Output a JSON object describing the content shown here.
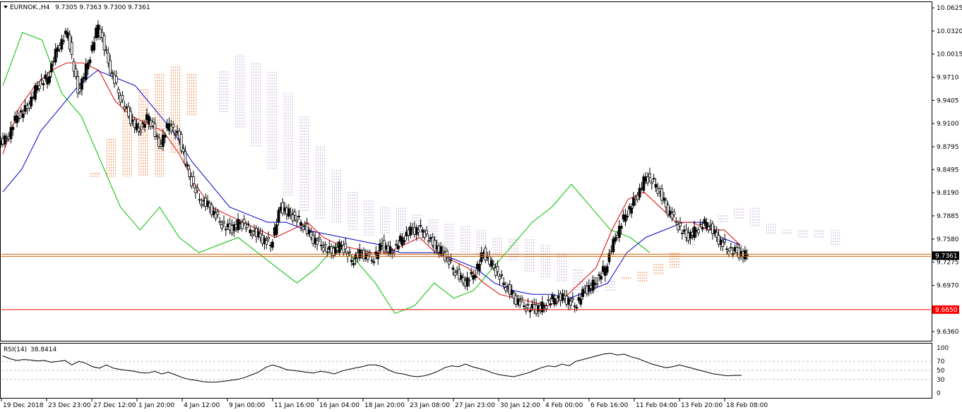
{
  "header": {
    "symbol_label": "EURNOK.,H4",
    "ohlc_label": "9.7305 9.7363 9.7300 9.7361",
    "menu_icon": "triangle-down-icon"
  },
  "colors": {
    "bull_body": "#000000",
    "bear_body": "#ffffff",
    "tenkan": "#dd0000",
    "kijun": "#0000cc",
    "chikou": "#00c000",
    "senkou_a": "#f08040",
    "senkou_b": "#c8b0d8",
    "price_line": "#d06000",
    "support_line": "#ff0000",
    "rsi_line": "#000000",
    "level_line": "#c0c0c0"
  },
  "chart_data": [
    {
      "type": "candlestick",
      "name": "EURNOK.,H4",
      "title": "EURNOK.,H4",
      "ohlc": {
        "open": 9.7305,
        "high": 9.7363,
        "low": 9.73,
        "close": 9.7361
      },
      "y_ticks": [
        "10.0625",
        "10.0320",
        "10.0015",
        "9.9710",
        "9.9405",
        "9.9100",
        "9.8795",
        "9.8495",
        "9.8190",
        "9.7885",
        "9.7580",
        "9.7275",
        "9.6970",
        "9.6360"
      ],
      "ylim": [
        9.624,
        10.07
      ],
      "x_ticks": [
        "19 Dec 2018",
        "23 Dec 23:00",
        "27 Dec 12:00",
        "1 Jan 20:00",
        "4 Jan 12:00",
        "9 Jan 00:00",
        "11 Jan 16:00",
        "16 Jan 04:00",
        "18 Jan 20:00",
        "23 Jan 08:00",
        "27 Jan 23:00",
        "30 Jan 12:00",
        "4 Feb 00:00",
        "6 Feb 16:00",
        "11 Feb 04:00",
        "13 Feb 20:00",
        "18 Feb 08:00"
      ],
      "current_price": {
        "value": 9.7361,
        "label": "9.7361"
      },
      "horizontal_line": {
        "value": 9.665,
        "label": "9.6650"
      },
      "close_path": [
        9.89,
        9.92,
        9.93,
        9.96,
        9.97,
        10.01,
        10.03,
        9.95,
        9.99,
        10.04,
        9.99,
        9.95,
        9.92,
        9.9,
        9.92,
        9.88,
        9.91,
        9.89,
        9.84,
        9.81,
        9.8,
        9.78,
        9.77,
        9.78,
        9.77,
        9.76,
        9.75,
        9.8,
        9.79,
        9.78,
        9.76,
        9.75,
        9.74,
        9.75,
        9.73,
        9.74,
        9.73,
        9.75,
        9.74,
        9.76,
        9.77,
        9.77,
        9.75,
        9.74,
        9.72,
        9.7,
        9.71,
        9.74,
        9.72,
        9.7,
        9.68,
        9.67,
        9.665,
        9.67,
        9.68,
        9.68,
        9.67,
        9.69,
        9.7,
        9.72,
        9.76,
        9.79,
        9.81,
        9.84,
        9.83,
        9.8,
        9.78,
        9.76,
        9.77,
        9.78,
        9.76,
        9.745,
        9.74,
        9.736
      ],
      "ichimoku": {
        "tenkan": [
          9.87,
          9.93,
          9.96,
          9.98,
          9.99,
          9.99,
          9.98,
          9.94,
          9.92,
          9.91,
          9.9,
          9.87,
          9.83,
          9.8,
          9.79,
          9.78,
          9.77,
          9.76,
          9.77,
          9.78,
          9.76,
          9.75,
          9.745,
          9.74,
          9.74,
          9.75,
          9.76,
          9.74,
          9.73,
          9.72,
          9.7,
          9.685,
          9.68,
          9.675,
          9.67,
          9.68,
          9.7,
          9.72,
          9.77,
          9.81,
          9.82,
          9.8,
          9.78,
          9.78,
          9.77,
          9.77,
          9.75
        ],
        "kijun": [
          9.82,
          9.85,
          9.9,
          9.93,
          9.96,
          9.98,
          9.97,
          9.96,
          9.93,
          9.9,
          9.86,
          9.83,
          9.8,
          9.79,
          9.78,
          9.78,
          9.77,
          9.765,
          9.76,
          9.755,
          9.75,
          9.74,
          9.74,
          9.74,
          9.73,
          9.72,
          9.7,
          9.69,
          9.685,
          9.685,
          9.68,
          9.69,
          9.7,
          9.74,
          9.76,
          9.77,
          9.78,
          9.78,
          9.76,
          9.75
        ],
        "chikou": [
          9.96,
          10.03,
          10.02,
          9.95,
          9.92,
          9.86,
          9.8,
          9.77,
          9.8,
          9.76,
          9.74,
          9.75,
          9.76,
          9.74,
          9.72,
          9.7,
          9.72,
          9.75,
          9.73,
          9.7,
          9.66,
          9.67,
          9.7,
          9.68,
          9.69,
          9.72,
          9.75,
          9.78,
          9.8,
          9.83,
          9.8,
          9.77,
          9.76,
          9.74
        ]
      }
    },
    {
      "type": "line",
      "title": "RSI(14) 38.8414",
      "label": "RSI(14)",
      "value_label": "38.8414",
      "y_ticks": [
        "100",
        "70",
        "50",
        "30",
        "0"
      ],
      "levels": [
        70,
        50,
        30
      ],
      "ylim": [
        0,
        100
      ],
      "values": [
        82,
        76,
        72,
        74,
        73,
        71,
        72,
        68,
        70,
        72,
        62,
        70,
        66,
        58,
        55,
        62,
        55,
        52,
        50,
        48,
        45,
        44,
        48,
        42,
        46,
        40,
        34,
        30,
        28,
        25,
        24,
        24,
        26,
        28,
        30,
        34,
        40,
        46,
        56,
        62,
        58,
        52,
        50,
        48,
        46,
        44,
        48,
        46,
        42,
        48,
        52,
        55,
        58,
        62,
        62,
        58,
        50,
        44,
        42,
        38,
        36,
        38,
        42,
        48,
        56,
        60,
        58,
        64,
        58,
        54,
        50,
        44,
        40,
        38,
        36,
        40,
        44,
        50,
        56,
        60,
        58,
        64,
        60,
        70,
        74,
        78,
        82,
        86,
        88,
        84,
        86,
        80,
        76,
        70,
        64,
        60,
        56,
        58,
        62,
        58,
        54,
        50,
        46,
        42,
        40,
        38,
        39,
        38.84
      ]
    }
  ]
}
